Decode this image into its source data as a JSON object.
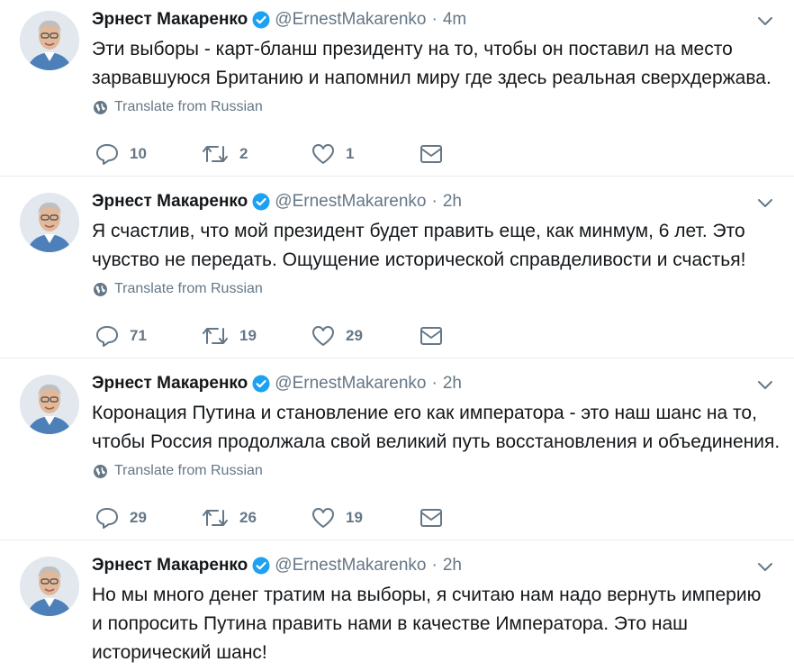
{
  "tweets": [
    {
      "author_name": "Эрнест Макаренко",
      "handle": "@ErnestMakarenko",
      "separator": "·",
      "time": "4m",
      "text_lines": [
        "Эти выборы - карт-бланш президенту на то, чтобы он поставил на место",
        "зарвавшуюся Британию и напомнил миру где здесь реальная сверхдержава."
      ],
      "translate": "Translate from Russian",
      "replies": "10",
      "retweets": "2",
      "likes": "1"
    },
    {
      "author_name": "Эрнест Макаренко",
      "handle": "@ErnestMakarenko",
      "separator": "·",
      "time": "2h",
      "text_lines": [
        "Я счастлив, что мой президент будет править еще, как минмум, 6 лет. Это",
        "чувство не передать. Ощущение исторической справделивости и счастья!"
      ],
      "translate": "Translate from Russian",
      "replies": "71",
      "retweets": "19",
      "likes": "29"
    },
    {
      "author_name": "Эрнест Макаренко",
      "handle": "@ErnestMakarenko",
      "separator": "·",
      "time": "2h",
      "text_lines": [
        "Коронация Путина и становление его как императора - это наш шанс на то,",
        "чтобы Россия продолжала свой великий путь восстановления и объединения."
      ],
      "translate": "Translate from Russian",
      "replies": "29",
      "retweets": "26",
      "likes": "19"
    },
    {
      "author_name": "Эрнест Макаренко",
      "handle": "@ErnestMakarenko",
      "separator": "·",
      "time": "2h",
      "text_lines": [
        "Но мы много денег тратим на выборы, я считаю нам надо вернуть империю",
        "и попросить Путина править нами в качестве Императора. Это наш",
        "исторический шанс!"
      ]
    }
  ],
  "colors": {
    "accent": "#1da1f2",
    "secondary_text": "#657786",
    "divider": "#e6ecf0"
  },
  "icons": [
    "verified-badge-icon",
    "chevron-down-icon",
    "globe-icon",
    "reply-icon",
    "retweet-icon",
    "like-icon",
    "message-icon"
  ]
}
